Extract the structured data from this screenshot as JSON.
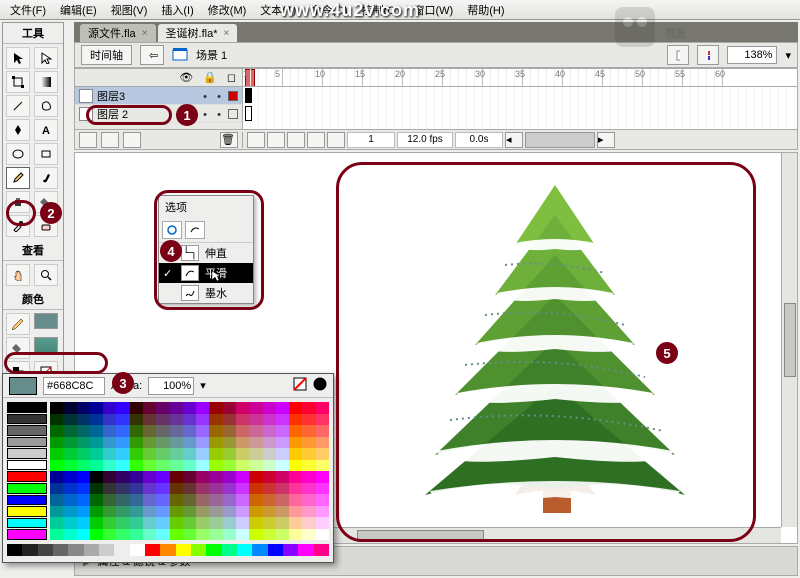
{
  "menu": {
    "file": "文件(F)",
    "edit": "编辑(E)",
    "view": "视图(V)",
    "insert": "插入(I)",
    "modify": "修改(M)",
    "text": "文本(T)",
    "commands": "命令(C)",
    "control": "控制(O)",
    "window": "窗口(W)",
    "help": "帮助(H)"
  },
  "watermark": "www.4u2v.com",
  "tabs": {
    "t1": "源文件.fla",
    "t2": "圣诞树.fla*"
  },
  "editbar": {
    "timeline": "时间轴",
    "scene": "场景 1",
    "zoom": "138%"
  },
  "tool_headers": {
    "tools": "工具",
    "view": "查看",
    "colors": "颜色"
  },
  "layers": {
    "l1": "图层3",
    "l2": "图层 2"
  },
  "timeline": {
    "frame": "1",
    "fps": "12.0 fps",
    "time": "0.0s"
  },
  "options": {
    "title": "选项",
    "straighten": "伸直",
    "smooth": "平滑",
    "ink": "墨水"
  },
  "color": {
    "hex": "#668C8C",
    "alpha_label": "Alpha:",
    "alpha": "100%"
  },
  "bottom": {
    "label": "属性 & 滤镜 & 参数"
  },
  "markers": {
    "m1": "1",
    "m2": "2",
    "m3": "3",
    "m4": "4",
    "m5": "5"
  }
}
